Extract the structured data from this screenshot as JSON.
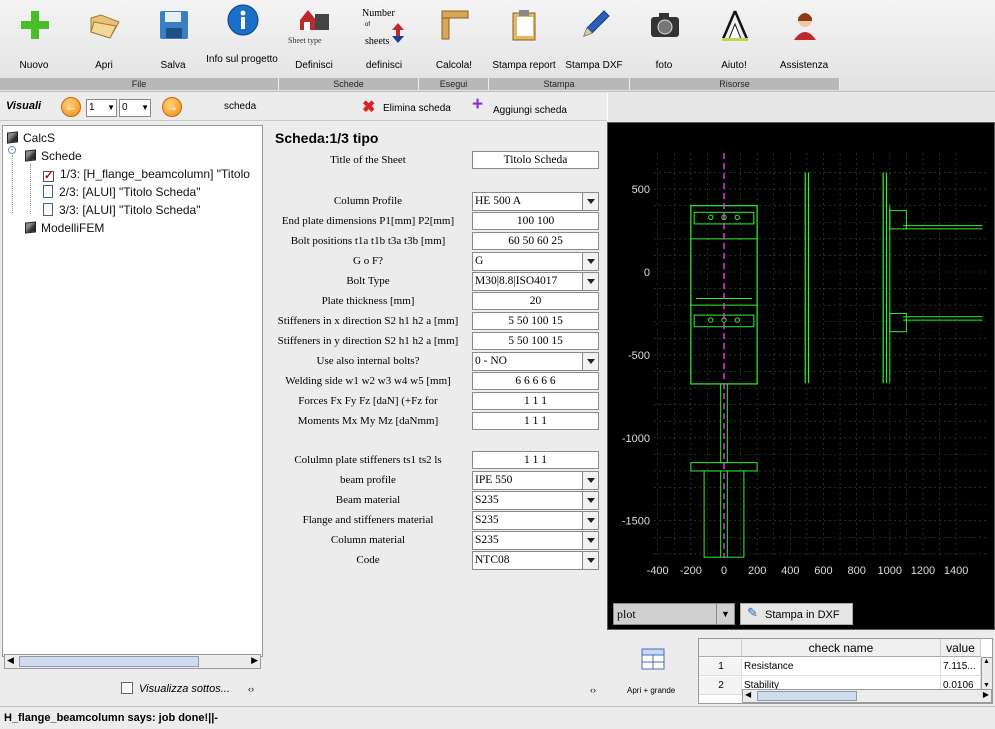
{
  "toolbar": {
    "buttons": [
      {
        "label": "Nuovo",
        "icon": "plus-icon"
      },
      {
        "label": "Apri",
        "icon": "folder-icon"
      },
      {
        "label": "Salva",
        "icon": "floppy-icon"
      },
      {
        "label": "Info sul progetto",
        "icon": "info-icon"
      },
      {
        "label": "Definisci",
        "icon": "sheet-type-icon"
      },
      {
        "label": "definisci",
        "icon": "number-of-sheets-icon"
      },
      {
        "label": "Calcola!",
        "icon": "ruler-square-icon"
      },
      {
        "label": "Stampa report",
        "icon": "clipboard-icon"
      },
      {
        "label": "Stampa DXF",
        "icon": "pencil-icon"
      },
      {
        "label": "foto",
        "icon": "camera-icon"
      },
      {
        "label": "Aiuto!",
        "icon": "tipi-logo-icon"
      },
      {
        "label": "Assistenza",
        "icon": "operator-icon"
      }
    ],
    "sheet_type_caption": "Sheet type",
    "number_caption": "Number",
    "of_caption": "of",
    "sheets_caption": "sheets",
    "groups": [
      "File",
      "Schede",
      "Esegui",
      "Stampa",
      "Risorse"
    ]
  },
  "nav": {
    "title": "Visuali",
    "spin1": "1",
    "spin2": "0",
    "sheet_label": "scheda",
    "delete": "Elimina scheda",
    "add": "Aggiungi scheda"
  },
  "tree": {
    "root": "CalcS",
    "schede": "Schede",
    "items": [
      "1/3: [H_flange_beamcolumn] \"Titolo",
      "2/3: [ALUI] \"Titolo Scheda\"",
      "3/3: [ALUI] \"Titolo Scheda\""
    ],
    "fem": "ModelliFEM"
  },
  "show_sub": "Visualizza sottos...",
  "form": {
    "title": "Scheda:1/3 tipo",
    "sheet_title_label": "Title of the Sheet",
    "sheet_title_value": "Titolo Scheda",
    "rows": [
      {
        "label": "Column Profile",
        "value": "HE 500 A",
        "kind": "select"
      },
      {
        "label": "End plate dimensions P1[mm] P2[mm]",
        "value": "100 100",
        "kind": "input"
      },
      {
        "label": "Bolt positions t1a t1b t3a t3b [mm]",
        "value": "60 50 60 25",
        "kind": "input"
      },
      {
        "label": "G o F?",
        "value": "G",
        "kind": "select"
      },
      {
        "label": "Bolt Type",
        "value": "M30|8.8|ISO4017",
        "kind": "select"
      },
      {
        "label": "Plate thickness [mm]",
        "value": "20",
        "kind": "input"
      },
      {
        "label": "Stiffeners in x direction S2 h1 h2 a [mm]",
        "value": "5 50 100 15",
        "kind": "input"
      },
      {
        "label": "Stiffeners in y direction S2 h1 h2 a [mm]",
        "value": "5 50 100 15",
        "kind": "input"
      },
      {
        "label": "Use also internal bolts?",
        "value": "0 - NO",
        "kind": "select"
      },
      {
        "label": "Welding side w1 w2 w3 w4 w5 [mm]",
        "value": "6 6 6 6 6",
        "kind": "input"
      },
      {
        "label": "Forces Fx Fy Fz [daN] (+Fz for",
        "value": "1 1 1",
        "kind": "input"
      },
      {
        "label": "Moments Mx My Mz [daNmm]",
        "value": "1 1 1",
        "kind": "input"
      }
    ],
    "rows2": [
      {
        "label": "Colulmn plate stiffeners ts1 ts2 ls",
        "value": "1 1 1",
        "kind": "input"
      },
      {
        "label": "beam profile",
        "value": "IPE 550",
        "kind": "select"
      },
      {
        "label": "Beam material",
        "value": "S235",
        "kind": "select"
      },
      {
        "label": "Flange and stiffeners material",
        "value": "S235",
        "kind": "select"
      },
      {
        "label": "Column material",
        "value": "S235",
        "kind": "select"
      },
      {
        "label": "Code",
        "value": "NTC08",
        "kind": "select"
      }
    ]
  },
  "plot": {
    "y_ticks": [
      "500",
      "0",
      "-500",
      "-1000",
      "-1500"
    ],
    "x_ticks": [
      "-400",
      "-200",
      "0",
      "200",
      "400",
      "600",
      "800",
      "1000",
      "1200",
      "1400"
    ],
    "select": "plot",
    "print_dxf": "Stampa in DXF"
  },
  "results": {
    "open_label": "Apri + grande",
    "columns": [
      "check name",
      "value"
    ],
    "rows": [
      {
        "n": "1",
        "name": "Resistance",
        "value": "7.115..."
      },
      {
        "n": "2",
        "name": "Stability",
        "value": "0.0106"
      }
    ]
  },
  "status": "H_flange_beamcolumn says: job done!||-"
}
